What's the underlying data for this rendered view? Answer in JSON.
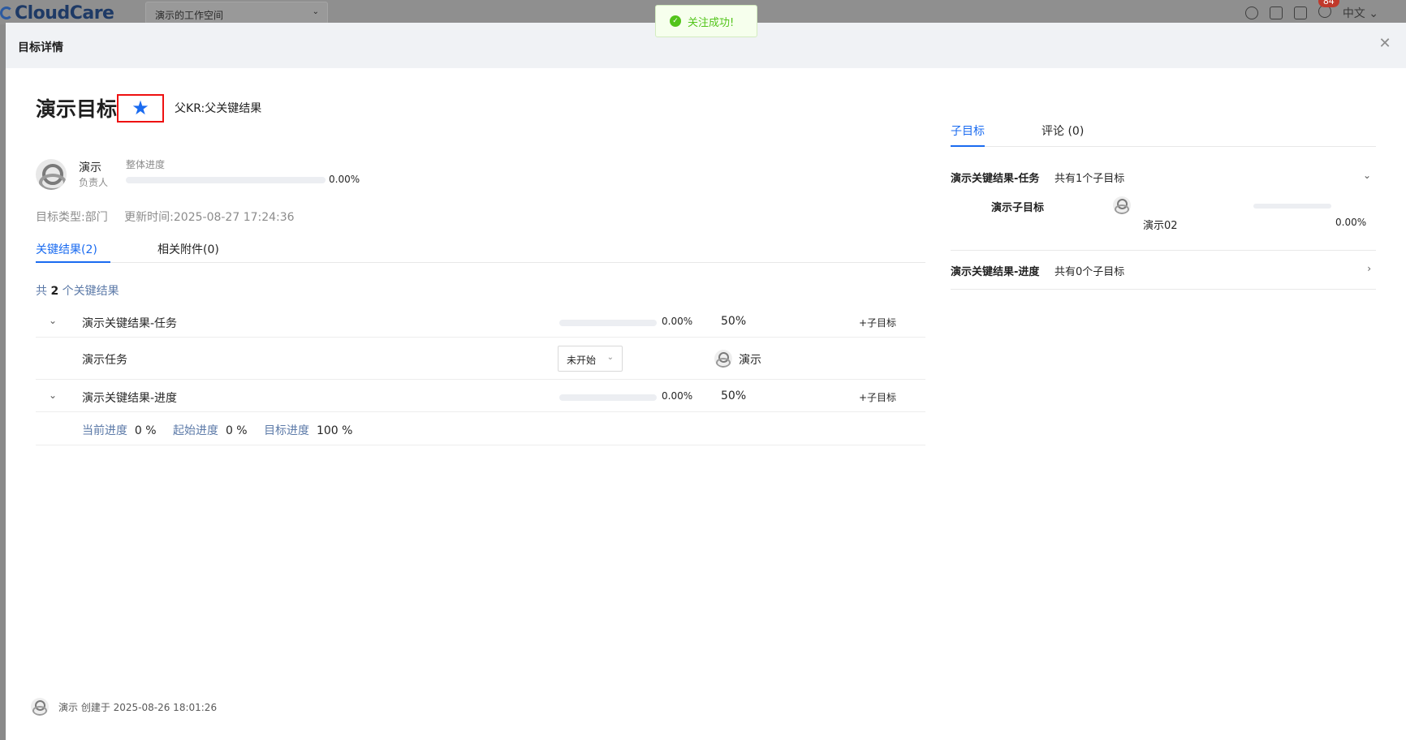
{
  "app": {
    "logo": "CloudCare",
    "workspace": "演示的工作空间",
    "language": "中文",
    "notification_count": "84"
  },
  "toast": {
    "message": "关注成功!"
  },
  "drawer": {
    "title": "目标详情"
  },
  "goal": {
    "title": "演示目标",
    "parent_kr": "父KR:父关键结果",
    "owner_name": "演示",
    "owner_role": "负责人",
    "progress_label": "整体进度",
    "overall_progress": "0.00%",
    "type": "目标类型:部门",
    "updated": "更新时间:2025-08-27 17:24:36",
    "starred": true
  },
  "tabs": [
    {
      "label": "关键结果(2)",
      "active": true
    },
    {
      "label": "相关附件(0)",
      "active": false
    }
  ],
  "kr_summary": {
    "prefix": "共 ",
    "count": "2",
    "suffix": " 个关键结果"
  },
  "key_results": [
    {
      "name": "演示关键结果-任务",
      "progress": "0.00%",
      "progress_value": 0,
      "weight": "50%",
      "add_label": "+子目标",
      "task": {
        "name": "演示任务",
        "status": "未开始",
        "owner": "演示"
      }
    },
    {
      "name": "演示关键结果-进度",
      "progress": "0.00%",
      "progress_value": 0,
      "weight": "50%",
      "add_label": "+子目标",
      "detail": {
        "current_label": "当前进度",
        "current_value": "0 %",
        "start_label": "起始进度",
        "start_value": "0 %",
        "target_label": "目标进度",
        "target_value": "100 %"
      }
    }
  ],
  "creator": {
    "text": "演示 创建于 2025-08-26 18:01:26"
  },
  "side": {
    "tabs": [
      {
        "label": "子目标",
        "active": true
      },
      {
        "label": "评论 (0)",
        "active": false
      }
    ],
    "groups": [
      {
        "title": "演示关键结果-任务",
        "count": "共有1个子目标",
        "expanded": true,
        "children": [
          {
            "name": "演示子目标",
            "owner": "演示02",
            "progress": "0.00%",
            "progress_value": 0
          }
        ]
      },
      {
        "title": "演示关键结果-进度",
        "count": "共有0个子目标",
        "expanded": false,
        "children": []
      }
    ]
  },
  "colors": {
    "accent": "#1a6bf0",
    "star_highlight": "#ee1111",
    "success": "#52c41a"
  },
  "icons": {
    "close": "close-icon",
    "star": "star-icon",
    "caret_down": "chevron-down-icon",
    "caret_right": "chevron-right-icon",
    "success": "check-circle-icon"
  }
}
